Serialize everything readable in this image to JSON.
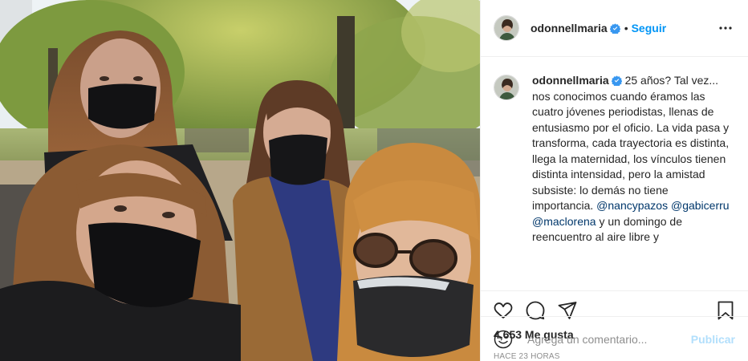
{
  "header": {
    "username": "odonnellmaria",
    "separator": "•",
    "follow_label": "Seguir",
    "more_icon": "more-options-icon"
  },
  "caption": {
    "username": "odonnellmaria",
    "text_before": " 25 años? Tal vez... nos conocimos cuando éramos las cuatro jóvenes periodistas, llenas de entusiasmo por el oficio. La vida pasa y transforma, cada trayectoria es distinta, llega la maternidad, los vínculos tienen distinta intensidad, pero la amistad subsiste: lo demás no tiene importancia. ",
    "mention_1": "@nancypazos",
    "mention_2": "@gabicerru",
    "mention_3": "@maclorena",
    "text_after": " y un domingo de reencuentro al aire libre y"
  },
  "actions": {
    "icons": [
      "heart-icon",
      "comment-icon",
      "share-icon",
      "save-icon"
    ],
    "likes": "4,653 Me gusta",
    "timestamp": "HACE 23 HORAS"
  },
  "add_comment": {
    "placeholder": "Agrega un comentario...",
    "post_label": "Publicar"
  },
  "colors": {
    "accent": "#0095f6",
    "post_disabled": "#b2dffc",
    "mention": "#00376b",
    "verified": "#3897f0"
  }
}
